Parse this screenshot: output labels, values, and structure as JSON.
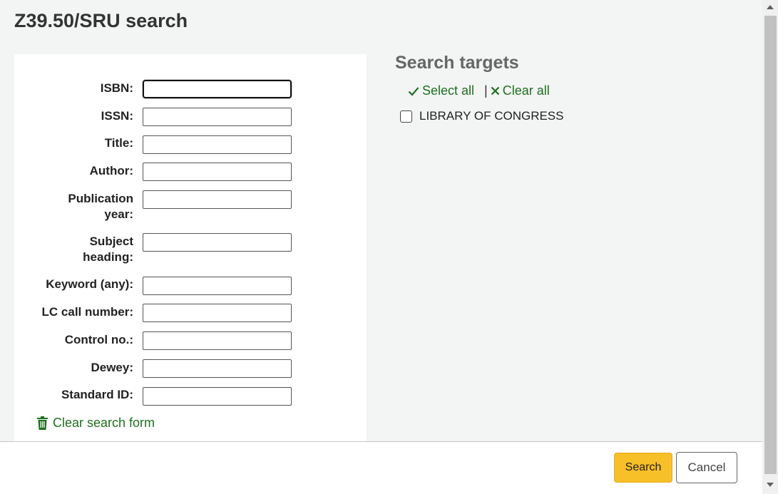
{
  "title": "Z39.50/SRU search",
  "form": {
    "fields": [
      {
        "label": "ISBN:",
        "value": ""
      },
      {
        "label": "ISSN:",
        "value": ""
      },
      {
        "label": "Title:",
        "value": ""
      },
      {
        "label": "Author:",
        "value": ""
      },
      {
        "label_line1": "Publication",
        "label_line2": "year:",
        "value": ""
      },
      {
        "label_line1": "Subject",
        "label_line2": "heading:",
        "value": ""
      },
      {
        "label": "Keyword (any):",
        "value": ""
      },
      {
        "label": "LC call number:",
        "value": ""
      },
      {
        "label": "Control no.:",
        "value": ""
      },
      {
        "label": "Dewey:",
        "value": ""
      },
      {
        "label": "Standard ID:",
        "value": ""
      }
    ],
    "clear_label": "Clear search form"
  },
  "targets": {
    "title": "Search targets",
    "select_all": "Select all",
    "separator": "|",
    "clear_all": "Clear all",
    "items": [
      {
        "label": "LIBRARY OF CONGRESS",
        "checked": false
      }
    ]
  },
  "footer": {
    "search_label": "Search",
    "cancel_label": "Cancel"
  },
  "colors": {
    "link_green": "#1f6f1f",
    "search_button": "#f7bf28",
    "background": "#f3f4f4"
  },
  "icons": {
    "select_all": "check-icon",
    "clear_all": "x-icon",
    "clear_form": "trash-icon"
  }
}
